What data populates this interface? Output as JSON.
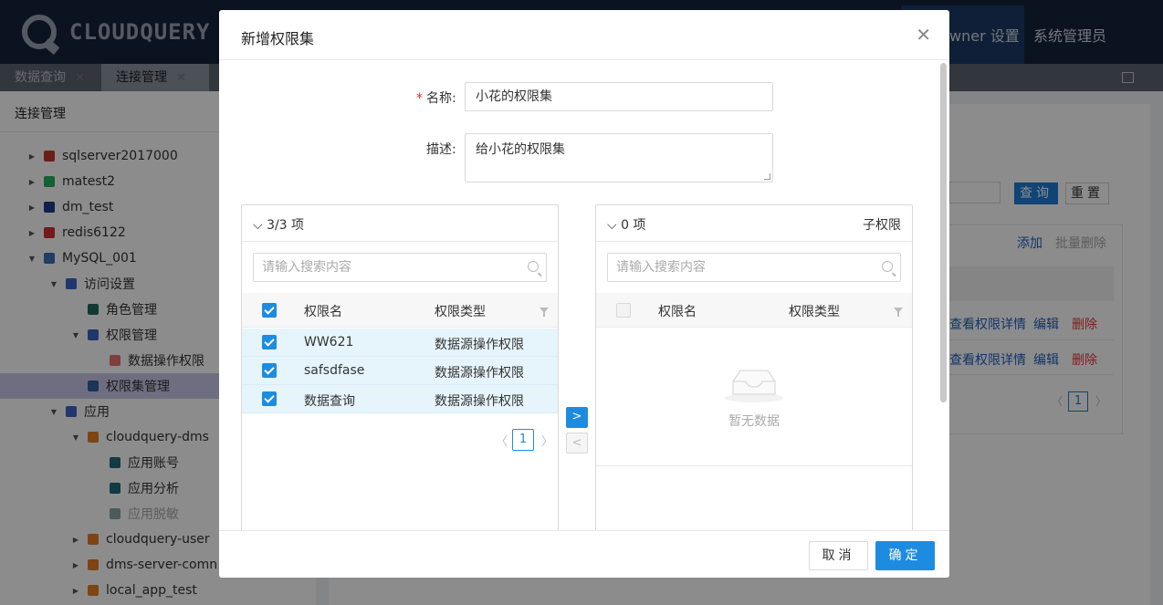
{
  "header": {
    "logo_text": "CLOUDQUERY",
    "nav_owner_settings": "wner 设置",
    "nav_sysadmin": "系统管理员"
  },
  "tabs": [
    {
      "label": "数据查询",
      "close": "✕"
    },
    {
      "label": "连接管理",
      "close": "✕"
    }
  ],
  "sidebar": {
    "title": "连接管理",
    "items": [
      {
        "label": "sqlserver2017000",
        "expand": "▶",
        "icon": "sqlserver-icon",
        "color": "#c0392b"
      },
      {
        "label": "matest2",
        "expand": "▶",
        "icon": "mongodb-leaf-icon",
        "color": "#27ae60"
      },
      {
        "label": "dm_test",
        "expand": "▶",
        "icon": "dm-database-icon",
        "color": "#1f3a8a"
      },
      {
        "label": "redis6122",
        "expand": "▶",
        "icon": "redis-icon",
        "color": "#d32f2f"
      },
      {
        "label": "MySQL_001",
        "expand": "▼",
        "icon": "mysql-icon",
        "color": "#3d6fb6"
      },
      {
        "label": "访问设置",
        "expand": "▼",
        "icon": "list-icon",
        "color": "#3b63c9"
      },
      {
        "label": "角色管理",
        "expand": "",
        "icon": "users-icon",
        "color": "#1f6b5c"
      },
      {
        "label": "权限管理",
        "expand": "▼",
        "icon": "list-icon",
        "color": "#3b63c9"
      },
      {
        "label": "数据操作权限",
        "expand": "",
        "icon": "document-icon",
        "color": "#e57373"
      },
      {
        "label": "权限集管理",
        "expand": "",
        "icon": "folder-icon",
        "color": "#2f63a3"
      },
      {
        "label": "应用",
        "expand": "▼",
        "icon": "list-icon",
        "color": "#3b63c9"
      },
      {
        "label": "cloudquery-dms",
        "expand": "▼",
        "icon": "cube-icon",
        "color": "#e67e22"
      },
      {
        "label": "应用账号",
        "expand": "",
        "icon": "cube-small-icon",
        "color": "#1f6b7a"
      },
      {
        "label": "应用分析",
        "expand": "",
        "icon": "cube-small-icon",
        "color": "#1f6b7a"
      },
      {
        "label": "应用脱敏",
        "expand": "",
        "icon": "cube-small-icon",
        "color": "#8aa5ab"
      },
      {
        "label": "cloudquery-user",
        "expand": "▶",
        "icon": "cube-icon",
        "color": "#e67e22"
      },
      {
        "label": "dms-server-comn",
        "expand": "▶",
        "icon": "cube-icon",
        "color": "#e67e22"
      },
      {
        "label": "local_app_test",
        "expand": "▶",
        "icon": "cube-icon",
        "color": "#e67e22"
      }
    ]
  },
  "content": {
    "query_btn": "查询",
    "reset_btn": "重置",
    "add_link": "添加",
    "batch_delete_link": "批量删除",
    "rows": [
      {
        "view": "查看权限详情",
        "edit": "编辑",
        "delete": "删除"
      },
      {
        "view": "查看权限详情",
        "edit": "编辑",
        "delete": "删除"
      }
    ],
    "page": "1"
  },
  "modal": {
    "title": "新增权限集",
    "close": "✕",
    "name_required": "*",
    "name_label": "名称:",
    "name_value": "小花的权限集",
    "desc_label": "描述:",
    "desc_value": "给小花的权限集",
    "left": {
      "count": "3/3 项",
      "search_placeholder": "请输入搜索内容",
      "col_name": "权限名",
      "col_type": "权限类型",
      "rows": [
        {
          "name": "WW621",
          "type": "数据源操作权限"
        },
        {
          "name": "safsdfase",
          "type": "数据源操作权限"
        },
        {
          "name": "数据查询",
          "type": "数据源操作权限"
        }
      ],
      "page": "1"
    },
    "right": {
      "count": "0 项",
      "title": "子权限",
      "search_placeholder": "请输入搜索内容",
      "col_name": "权限名",
      "col_type": "权限类型",
      "empty_text": "暂无数据"
    },
    "move_right": ">",
    "move_left": "<",
    "cancel": "取消",
    "ok": "确定"
  },
  "colors": {
    "primary": "#1d8ce0",
    "header_bg": "#14233d",
    "danger": "#e53935"
  }
}
